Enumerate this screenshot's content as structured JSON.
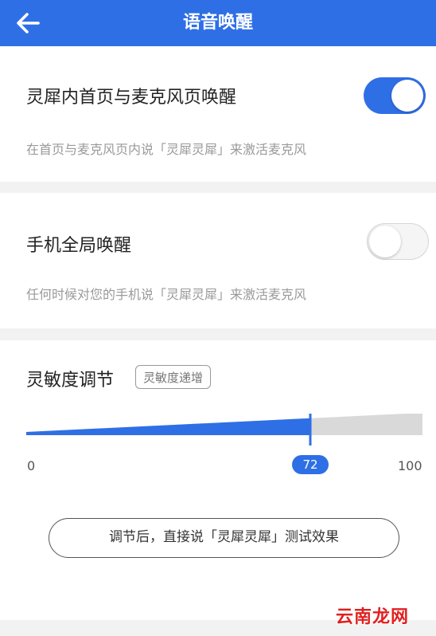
{
  "header": {
    "title": "语音唤醒"
  },
  "home_wake": {
    "title": "灵犀内首页与麦克风页唤醒",
    "description": "在首页与麦克风页内说「灵犀灵犀」来激活麦克风",
    "enabled": true
  },
  "global_wake": {
    "title": "手机全局唤醒",
    "description": "任何时候对您的手机说「灵犀灵犀」来激活麦克风",
    "enabled": false
  },
  "sensitivity": {
    "title": "灵敏度调节",
    "tag": "灵敏度递增",
    "min_label": "0",
    "max_label": "100",
    "value_label": "72",
    "value": 72,
    "test_button": "调节后，直接说「灵犀灵犀」测试效果"
  },
  "watermark": "云南龙网",
  "colors": {
    "accent": "#2f6fe6",
    "track_inactive": "#d9d9d9"
  }
}
